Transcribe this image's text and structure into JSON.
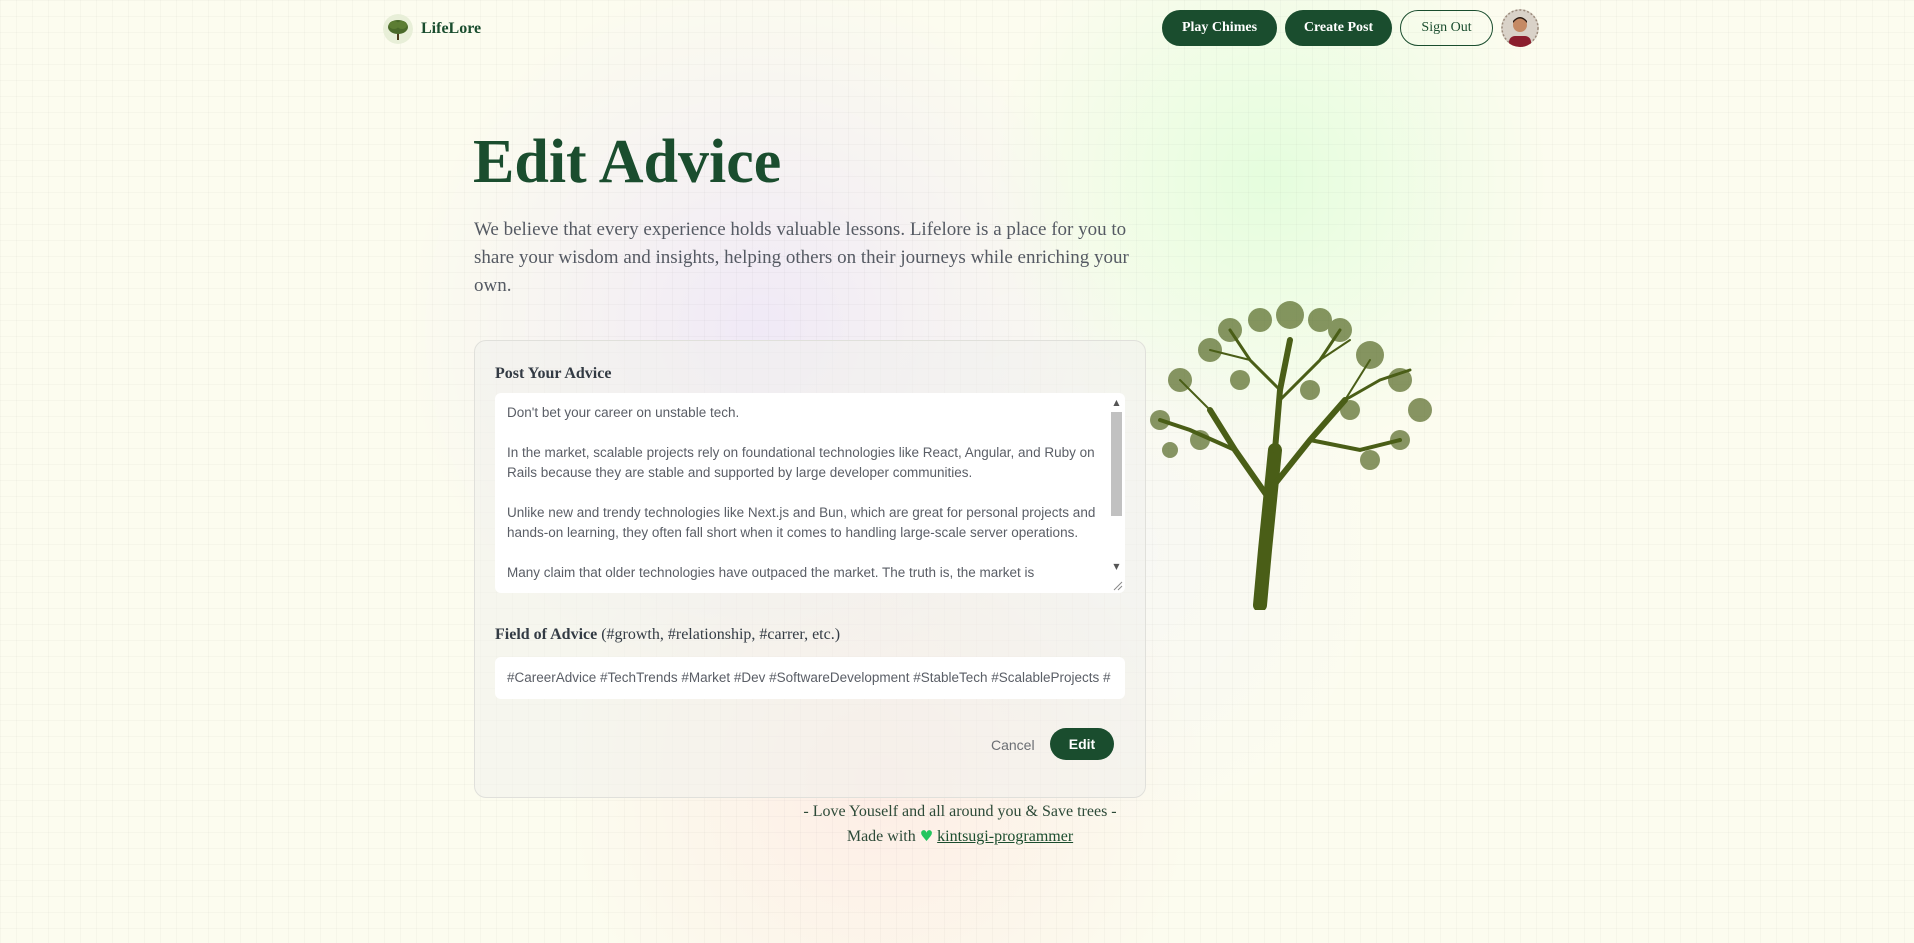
{
  "nav": {
    "brand": "LifeLore",
    "play_chimes": "Play Chimes",
    "create_post": "Create Post",
    "sign_out": "Sign Out"
  },
  "hero": {
    "title": "Edit Advice",
    "description": "We believe that every experience holds valuable lessons. Lifelore is a place for you to share your wisdom and insights, helping others on their journeys while enriching your own."
  },
  "form": {
    "advice_label": "Post Your Advice",
    "advice_value": "Don't bet your career on unstable tech.\n\nIn the market, scalable projects rely on foundational technologies like React, Angular, and Ruby on Rails because they are stable and supported by large developer communities.\n\nUnlike new and trendy technologies like Next.js and Bun, which are great for personal projects and hands-on learning, they often fall short when it comes to handling large-scale server operations.\n\nMany claim that older technologies have outpaced the market. The truth is, the market is",
    "field_label": "Field of Advice",
    "field_hint": "(#growth, #relationship, #carrer, etc.)",
    "field_value": "#CareerAdvice #TechTrends #Market #Dev #SoftwareDevelopment #StableTech #ScalableProjects #",
    "cancel_label": "Cancel",
    "edit_label": "Edit"
  },
  "footer": {
    "tagline": "- Love Youself and all around you & Save trees -",
    "made_with": "Made with",
    "author": "kintsugi-programmer"
  },
  "colors": {
    "accent": "#1a4d2e",
    "heart": "#22c55e",
    "tree": "#4a5e17"
  },
  "icons": {
    "brand_logo": "tree-logo-icon",
    "heart": "heart-icon",
    "avatar": "user-avatar"
  }
}
